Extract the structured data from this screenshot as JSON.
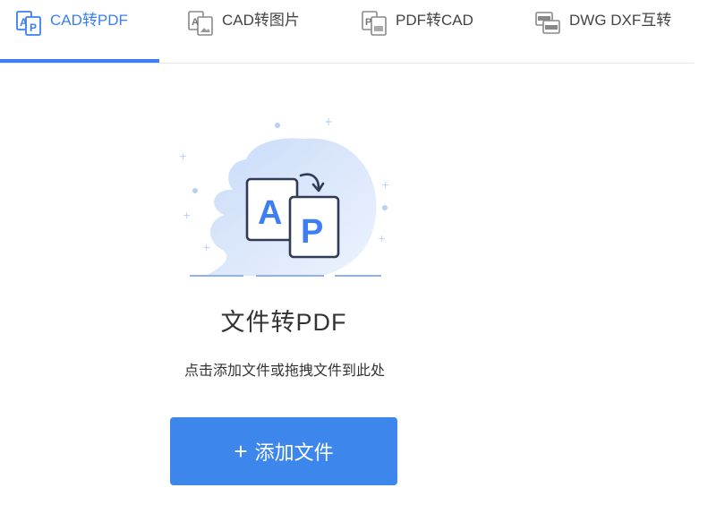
{
  "tabs": [
    {
      "label": "CAD转PDF",
      "icon": "cad-to-pdf-icon",
      "active": true
    },
    {
      "label": "CAD转图片",
      "icon": "cad-to-image-icon",
      "active": false
    },
    {
      "label": "PDF转CAD",
      "icon": "pdf-to-cad-icon",
      "active": false
    },
    {
      "label": "DWG DXF互转",
      "icon": "dwg-dxf-convert-icon",
      "active": false
    }
  ],
  "main": {
    "title": "文件转PDF",
    "hint": "点击添加文件或拖拽文件到此处",
    "add_button": {
      "plus": "+",
      "label": "添加文件"
    },
    "illustration": {
      "letter_a": "A",
      "letter_p": "P"
    }
  },
  "colors": {
    "accent": "#3d7ff2",
    "button": "#3d87ec",
    "illustration_blob": "#dce8fb"
  }
}
